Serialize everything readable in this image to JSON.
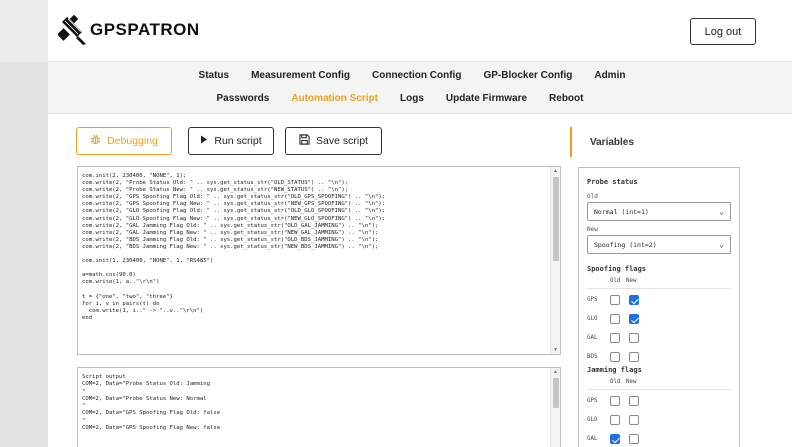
{
  "header": {
    "logo_text": "GPSPATRON",
    "logout_label": "Log out"
  },
  "nav": {
    "row1": [
      "Status",
      "Measurement Config",
      "Connection Config",
      "GP-Blocker Config",
      "Admin"
    ],
    "row2": [
      "Passwords",
      "Automation Script",
      "Logs",
      "Update Firmware",
      "Reboot"
    ],
    "active": "Automation Script"
  },
  "toolbar": {
    "debug_label": "Debugging",
    "run_label": "Run script",
    "save_label": "Save script"
  },
  "editor": {
    "code": "com.init(2, 230400, \"NONE\", 1);\ncom.write(2, \"Probe Status Old: \" .. sys.get_status_str(\"OLD_STATUS\") .. \"\\n\");\ncom.write(2, \"Probe Status New: \" .. sys.get_status_str(\"NEW_STATUS\") .. \"\\n\");\ncom.write(2, \"GPS Spoofing Flag Old: \" .. sys.get_status_str(\"OLD_GPS_SPOOFING\") .. \"\\n\");\ncom.write(2, \"GPS Spoofing Flag New: \" .. sys.get_status_str(\"NEW_GPS_SPOOFING\") .. \"\\n\");\ncom.write(2, \"GLO Spoofing Flag Old: \" .. sys.get_status_str(\"OLD_GLO_SPOOFING\") .. \"\\n\");\ncom.write(2, \"GLO Spoofing Flag New: \" .. sys.get_status_str(\"NEW_GLO_SPOOFING\") .. \"\\n\");\ncom.write(2, \"GAL Jamming Flag Old: \" .. sys.get_status_str(\"OLD_GAL_JAMMING\") .. \"\\n\");\ncom.write(2, \"GAL Jamming Flag New: \" .. sys.get_status_str(\"NEW_GAL_JAMMING\") .. \"\\n\");\ncom.write(2, \"BDS Jamming Flag Old: \" .. sys.get_status_str(\"OLD_BDS_JAMMING\") .. \"\\n\");\ncom.write(2, \"BDS Jamming Flag New: \" .. sys.get_status_str(\"NEW_BDS_JAMMING\") .. \"\\n\");\n\ncom.init(1, 230400, \"NONE\", 1, \"RS485\")\n\na=math.cos(90.0)\ncom.write(1, a..\"\\r\\n\")\n\nt = {\"one\", \"two\", \"three\"}\nfor i, v in pairs(t) do\n  com.write(1, i..\" -> \"..v..\"\\r\\n\")\nend"
  },
  "output": {
    "text": "Script output\nCOM=2, Data=\"Probe Status Old: Jamming\n\"\nCOM=2, Data=\"Probe Status New: Normal\n\"\nCOM=2, Data=\"GPS Spoofing Flag Old: false\n\"\nCOM=2, Data=\"GPS Spoofing Flag New: false"
  },
  "variables": {
    "title": "Variables",
    "probe_status": {
      "heading": "Probe status",
      "old_label": "Old",
      "old_value": "Normal (int=1)",
      "new_label": "New",
      "new_value": "Spoofing (int=2)"
    },
    "spoofing_flags": {
      "heading": "Spoofing flags",
      "col_old": "Old",
      "col_new": "New",
      "rows": [
        {
          "label": "GPS",
          "old": false,
          "new": true
        },
        {
          "label": "GLO",
          "old": false,
          "new": true
        },
        {
          "label": "GAL",
          "old": false,
          "new": false
        },
        {
          "label": "BDS",
          "old": false,
          "new": false
        }
      ]
    },
    "jamming_flags": {
      "heading": "Jamming flags",
      "col_old": "Old",
      "col_new": "New",
      "rows": [
        {
          "label": "GPS",
          "old": false,
          "new": false
        },
        {
          "label": "GLO",
          "old": false,
          "new": false
        },
        {
          "label": "GAL",
          "old": true,
          "new": false
        }
      ]
    }
  },
  "colors": {
    "accent": "#f0a020",
    "checkbox_checked": "#1f6fe0"
  }
}
